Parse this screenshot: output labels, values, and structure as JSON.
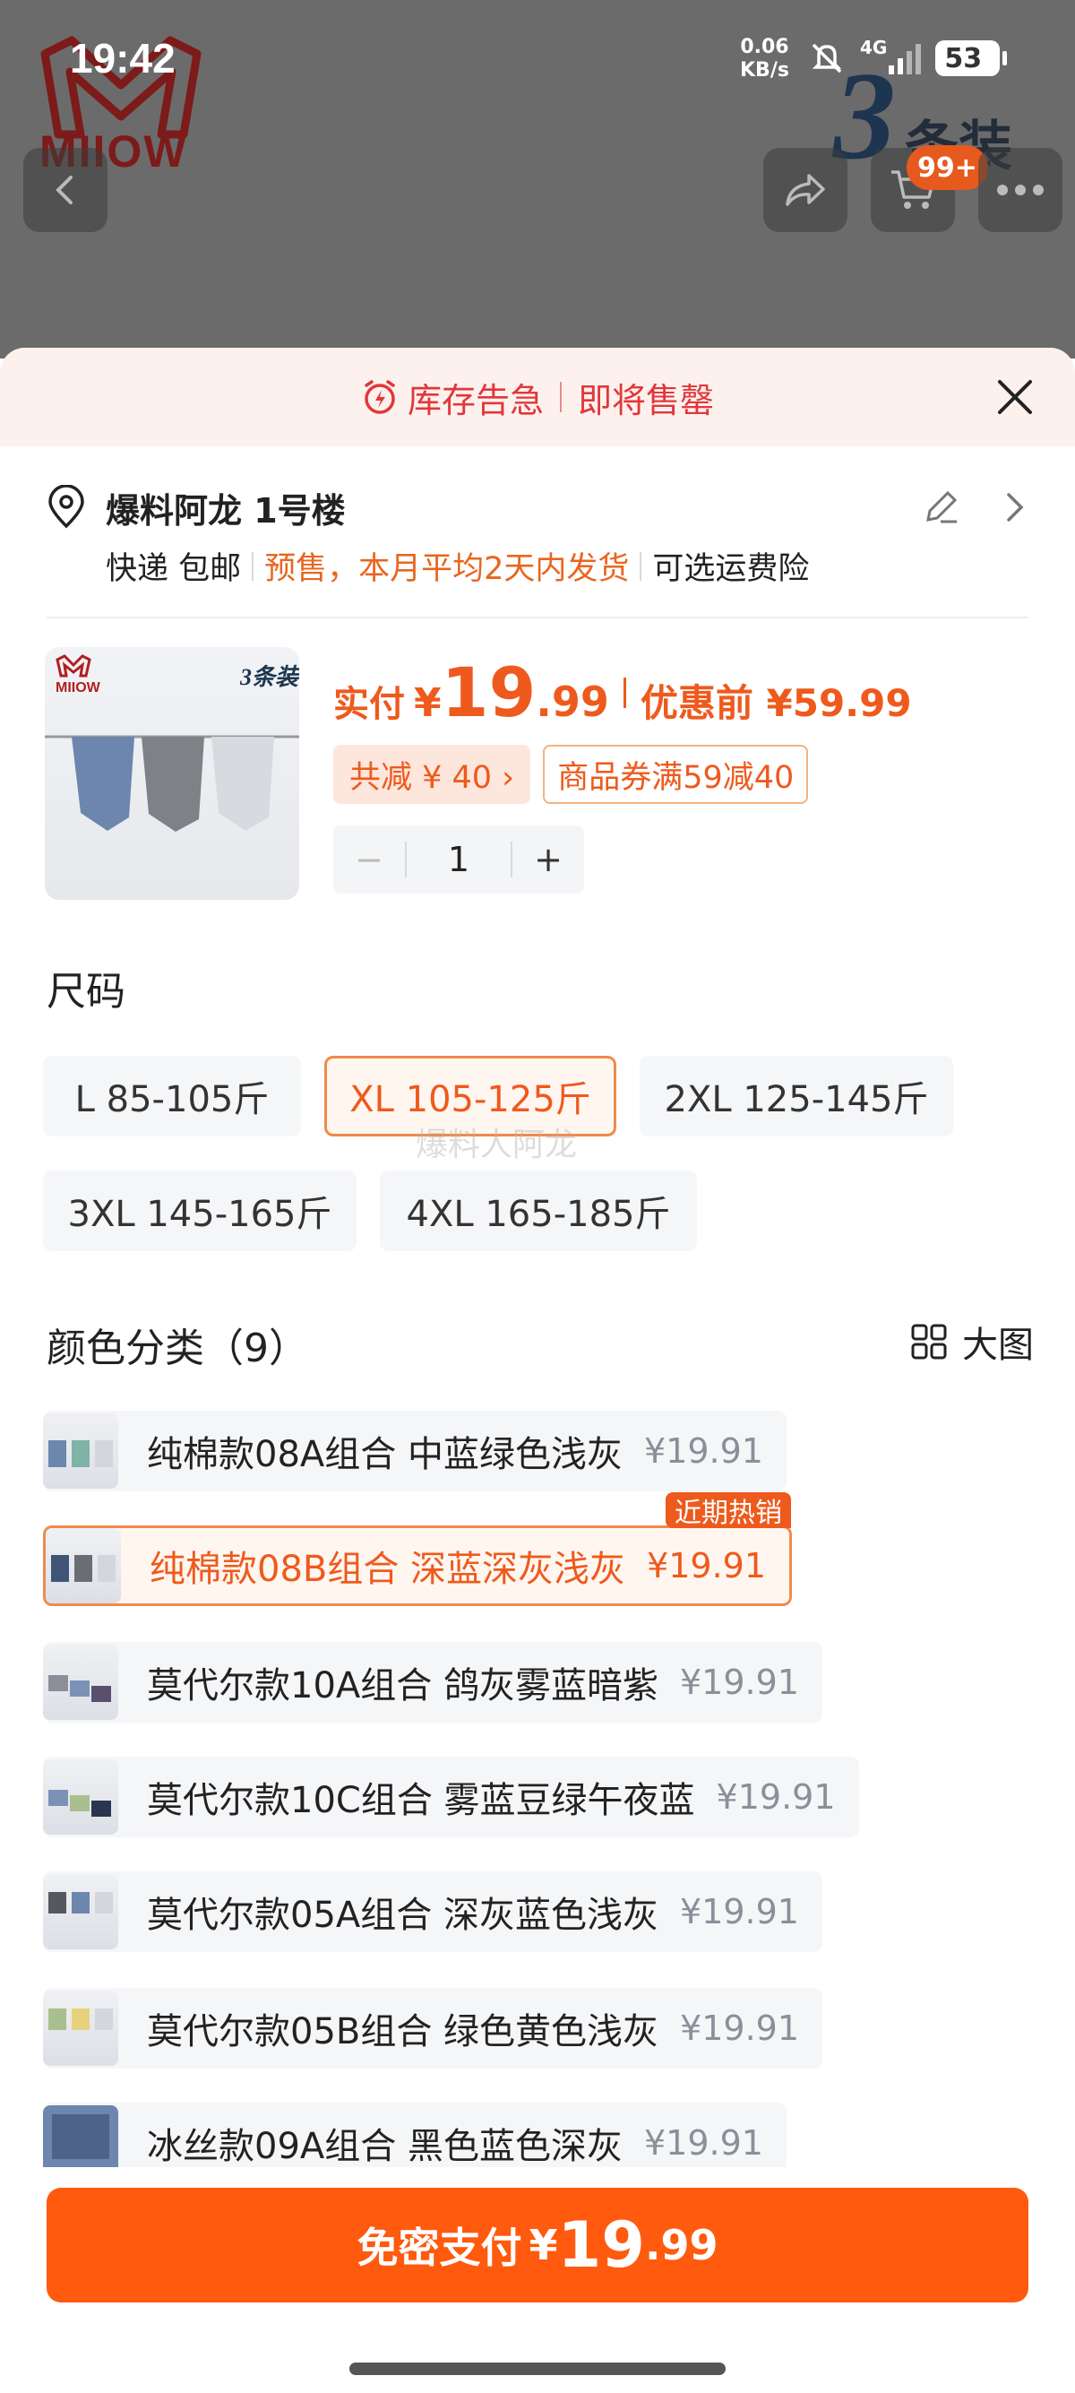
{
  "status_bar": {
    "time": "19:42",
    "net_speed_value": "0.06",
    "net_speed_unit": "KB/s",
    "network": "4G",
    "battery": "53"
  },
  "backdrop": {
    "brand": "MIIOW",
    "pack_number": "3",
    "pack_text": "条装",
    "cart_badge": "99+"
  },
  "alert": {
    "stock_warning": "库存告急",
    "sell_out_soon": "即将售罄"
  },
  "address": {
    "title": "爆料阿龙 1号楼",
    "delivery": "快递 包邮",
    "presale": "预售，本月平均2天内发货",
    "insurance": "可选运费险"
  },
  "product": {
    "image_brand": "MIIOW",
    "image_pack": "3条装",
    "pay_label": "实付",
    "currency": "¥",
    "price_int": "19",
    "price_dec": ".99",
    "original_label": "优惠前 ¥59.99",
    "total_saving": "共减 ¥ 40 ›",
    "coupon": "商品券满59减40",
    "quantity": "1",
    "minus": "−",
    "plus": "+"
  },
  "size": {
    "title": "尺码",
    "options": [
      "L 85-105斤",
      "XL 105-125斤",
      "2XL 125-145斤",
      "3XL 145-165斤",
      "4XL 165-185斤"
    ],
    "selected": "XL 105-125斤"
  },
  "watermark": "爆料人阿龙",
  "colors": {
    "title": "颜色分类（9）",
    "view_toggle": "大图",
    "hot_tag": "近期热销",
    "items": [
      {
        "name": "纯棉款08A组合 中蓝绿色浅灰",
        "price": "¥19.91"
      },
      {
        "name": "纯棉款08B组合 深蓝深灰浅灰",
        "price": "¥19.91"
      },
      {
        "name": "莫代尔款10A组合 鸽灰雾蓝暗紫",
        "price": "¥19.91"
      },
      {
        "name": "莫代尔款10C组合 雾蓝豆绿午夜蓝",
        "price": "¥19.91"
      },
      {
        "name": "莫代尔款05A组合 深灰蓝色浅灰",
        "price": "¥19.91"
      },
      {
        "name": "莫代尔款05B组合 绿色黄色浅灰",
        "price": "¥19.91"
      },
      {
        "name": "冰丝款09A组合 黑色蓝色深灰",
        "price": "¥19.91"
      }
    ]
  },
  "pay_button": {
    "label": "免密支付",
    "currency": "¥",
    "int": "19",
    "dec": ".99"
  },
  "colors_theme": {
    "accent": "#ee5a1d",
    "pay_button": "#ff5a0e",
    "alert_text": "#e2373a"
  }
}
